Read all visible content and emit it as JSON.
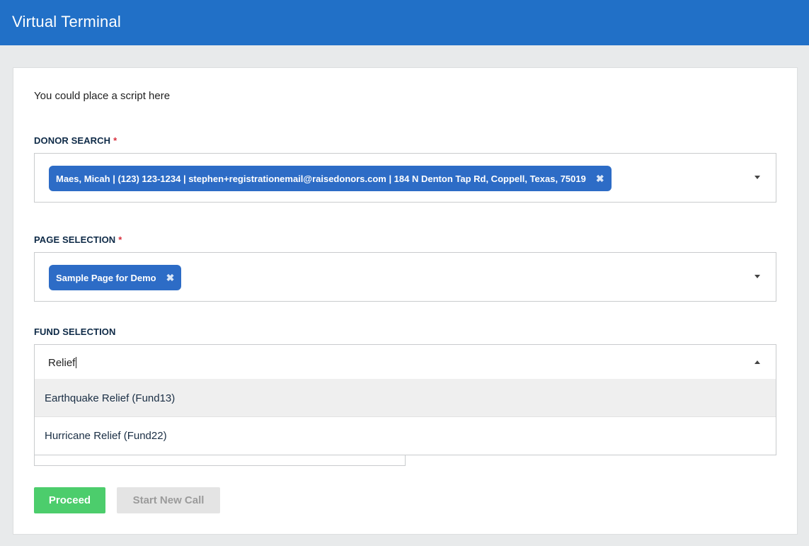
{
  "header": {
    "title": "Virtual Terminal"
  },
  "script_text": "You could place a script here",
  "donor_search": {
    "label": "DONOR SEARCH",
    "required_mark": "*",
    "selected": "Maes, Micah | (123) 123-1234 | stephen+registrationemail@raisedonors.com | 184 N Denton Tap Rd, Coppell, Texas, 75019",
    "remove_glyph": "✖"
  },
  "page_selection": {
    "label": "PAGE SELECTION",
    "required_mark": "*",
    "selected": "Sample Page for Demo",
    "remove_glyph": "✖"
  },
  "fund_selection": {
    "label": "FUND SELECTION",
    "search_value": "Relief",
    "options": [
      "Earthquake Relief (Fund13)",
      "Hurricane Relief (Fund22)"
    ]
  },
  "buttons": {
    "proceed": "Proceed",
    "start_new_call": "Start New Call"
  },
  "colors": {
    "header": "#2170c7",
    "tag": "#2d6cc6",
    "proceed": "#4ccd6c",
    "required": "#d9303e"
  }
}
